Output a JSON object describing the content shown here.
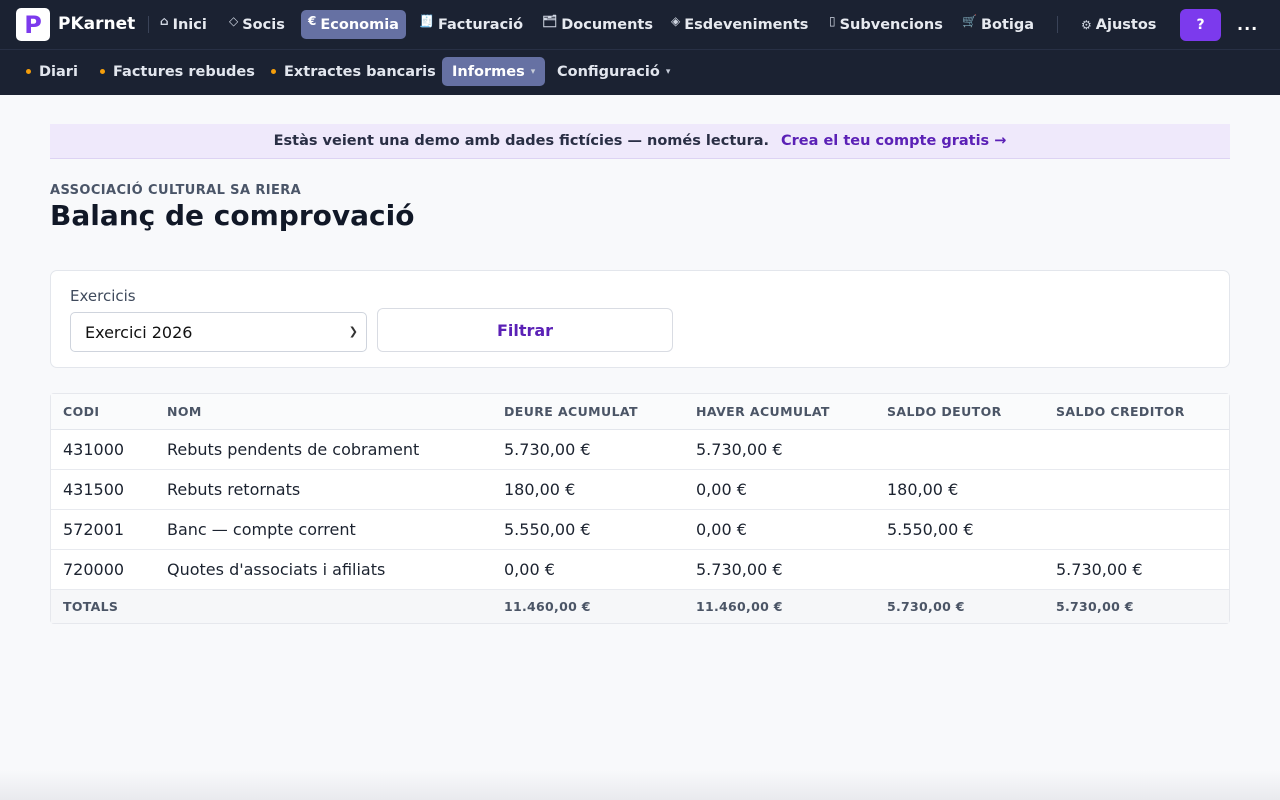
{
  "brand": {
    "logo_letter": "P",
    "name": "PKarnet",
    "accent": "#7c3aed"
  },
  "nav": {
    "items": [
      {
        "label": "Inici",
        "icon": "⌂"
      },
      {
        "label": "Socis",
        "icon": "◇"
      },
      {
        "label": "Economia",
        "icon": "€",
        "active": true
      },
      {
        "label": "Facturació",
        "icon": "🧾"
      },
      {
        "label": "Documents",
        "icon": "🗂"
      },
      {
        "label": "Esdeveniments",
        "icon": "◈"
      },
      {
        "label": "Subvencions",
        "icon": "▯"
      },
      {
        "label": "Botiga",
        "icon": "🛒"
      },
      {
        "label": "Ajustos",
        "icon": "⚙"
      }
    ],
    "help_label": "?",
    "more_label": "..."
  },
  "subnav": {
    "items": [
      {
        "label": "Diari"
      },
      {
        "label": "Factures rebudes"
      },
      {
        "label": "Extractes bancaris"
      },
      {
        "label": "Informes",
        "active": true,
        "dropdown": true
      },
      {
        "label": "Configuració",
        "dropdown": true
      }
    ]
  },
  "banner": {
    "text": "Estàs veient una demo amb dades fictícies — només lectura.",
    "link": "Crea el teu compte gratis →"
  },
  "page": {
    "org": "ASSOCIACIÓ CULTURAL SA RIERA",
    "title": "Balanç de comprovació"
  },
  "filter": {
    "label": "Exercicis",
    "selected": "Exercici 2026",
    "button": "Filtrar"
  },
  "table": {
    "columns": [
      "CODI",
      "NOM",
      "DEURE ACUMULAT",
      "HAVER ACUMULAT",
      "SALDO DEUTOR",
      "SALDO CREDITOR"
    ],
    "rows": [
      [
        "431000",
        "Rebuts pendents de cobrament",
        "5.730,00 €",
        "5.730,00 €",
        "",
        ""
      ],
      [
        "431500",
        "Rebuts retornats",
        "180,00 €",
        "0,00 €",
        "180,00 €",
        ""
      ],
      [
        "572001",
        "Banc — compte corrent",
        "5.550,00 €",
        "0,00 €",
        "5.550,00 €",
        ""
      ],
      [
        "720000",
        "Quotes d'associats i afiliats",
        "0,00 €",
        "5.730,00 €",
        "",
        "5.730,00 €"
      ]
    ],
    "totals": [
      "TOTALS",
      "",
      "11.460,00 €",
      "11.460,00 €",
      "5.730,00 €",
      "5.730,00 €"
    ]
  }
}
